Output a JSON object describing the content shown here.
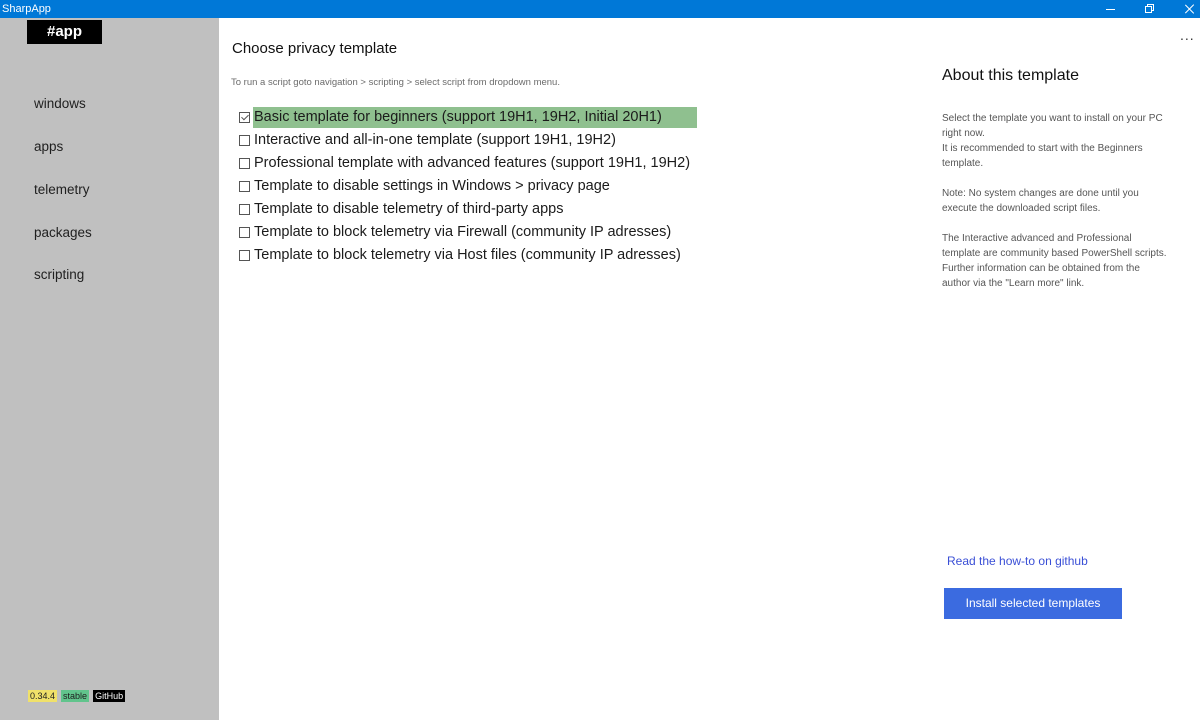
{
  "window": {
    "title": "SharpApp",
    "accent": "#0078d7"
  },
  "sidebar": {
    "logo": "#app",
    "items": [
      {
        "label": "windows"
      },
      {
        "label": "apps"
      },
      {
        "label": "telemetry"
      },
      {
        "label": "packages"
      },
      {
        "label": "scripting"
      }
    ],
    "badges": {
      "version": "0.34.4",
      "channel": "stable",
      "github": "GitHub"
    }
  },
  "main": {
    "title": "Choose privacy template",
    "hint": "To run a script goto navigation > scripting > select script from dropdown menu.",
    "templates": [
      {
        "label": "Basic template for beginners (support 19H1, 19H2, Initial 20H1)",
        "checked": true
      },
      {
        "label": "Interactive and all-in-one template (support 19H1, 19H2)",
        "checked": false
      },
      {
        "label": "Professional template with advanced features (support 19H1, 19H2)",
        "checked": false
      },
      {
        "label": "Template to disable settings in Windows > privacy page",
        "checked": false
      },
      {
        "label": "Template to disable telemetry of third-party apps",
        "checked": false
      },
      {
        "label": "Template to block telemetry via Firewall (community IP adresses)",
        "checked": false
      },
      {
        "label": "Template to block telemetry via Host files (community IP adresses)",
        "checked": false
      }
    ],
    "selected_color": "#8fc08f"
  },
  "about": {
    "more": "...",
    "title": "About this template",
    "paragraphs": [
      "Select the template you want to install on your PC right now.\nIt is recommended to start with the Beginners template.",
      "Note: No system changes are done until you execute the downloaded script files.",
      "The Interactive advanced and Professional template are community based PowerShell scripts. Further information can be obtained from the author via the \"Learn more\" link."
    ],
    "howto_link": "Read the how-to on github",
    "install_button": "Install selected templates"
  }
}
